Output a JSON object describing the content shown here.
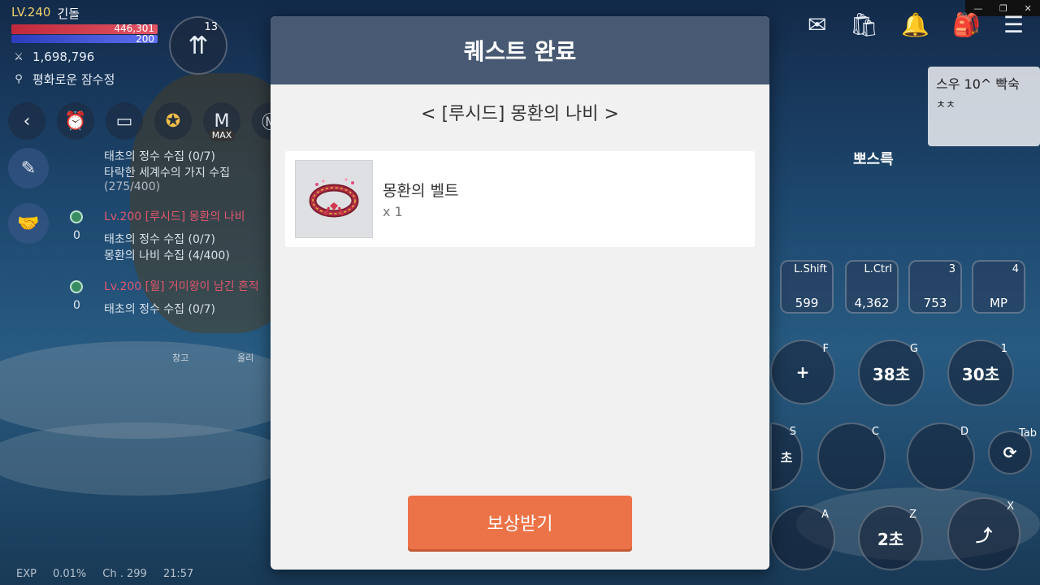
{
  "hud": {
    "level": "LV.240",
    "nickname": "긴돌",
    "hp": "446,301",
    "mp": "200",
    "combat_power": "1,698,796",
    "location": "평화로운 잠수정",
    "levelup_count": "13",
    "max_badge": "MAX",
    "exp_label": "EXP",
    "exp_value": "0.01%",
    "channel": "Ch . 299",
    "time": "21:57"
  },
  "quests": [
    {
      "count": "",
      "title": "",
      "lines": [
        "태초의 정수 수집 (0/7)",
        "타락한 세계수의 가지 수집",
        "(275/400)"
      ]
    },
    {
      "count": "0",
      "title": "Lv.200  [루시드] 몽환의 나비",
      "lines": [
        "태초의 정수 수집 (0/7)",
        "몽환의 나비 수집 (4/400)"
      ]
    },
    {
      "count": "0",
      "title": "Lv.200  [윌] 거미왕이 남긴 흔적",
      "lines": [
        "태초의 정수 수집 (0/7)"
      ]
    }
  ],
  "bottom_labels": {
    "storage": "창고",
    "other": "올리"
  },
  "right_hud": {
    "boss_card_title": "스우 10^ 빡숙",
    "boss_card_sub": "ㅊㅊ",
    "boss_name": "뽀스륵",
    "quick_slots": [
      {
        "key": "L.Shift",
        "value": "599"
      },
      {
        "key": "L.Ctrl",
        "value": "4,362"
      },
      {
        "key": "3",
        "value": "753"
      },
      {
        "key": "4",
        "value": "MP"
      }
    ],
    "skills": [
      {
        "key": "F",
        "label": "+"
      },
      {
        "key": "G",
        "label": "38초"
      },
      {
        "key": "1",
        "label": "30초"
      },
      {
        "key": "S",
        "label": "초"
      },
      {
        "key": "C",
        "label": ""
      },
      {
        "key": "D",
        "label": ""
      },
      {
        "key": "Tab",
        "label": ""
      },
      {
        "key": "A",
        "label": ""
      },
      {
        "key": "Z",
        "label": "2초"
      },
      {
        "key": "X",
        "label": ""
      }
    ]
  },
  "modal": {
    "title": "퀘스트 완료",
    "subtitle": "< [루시드] 몽환의 나비 >",
    "reward": {
      "name": "몽환의 벨트",
      "qty": "x 1",
      "icon": "belt-icon"
    },
    "button": "보상받기"
  },
  "colors": {
    "modal_header": "#485a73",
    "button": "#ec7347",
    "quest_title": "#e0566d"
  }
}
